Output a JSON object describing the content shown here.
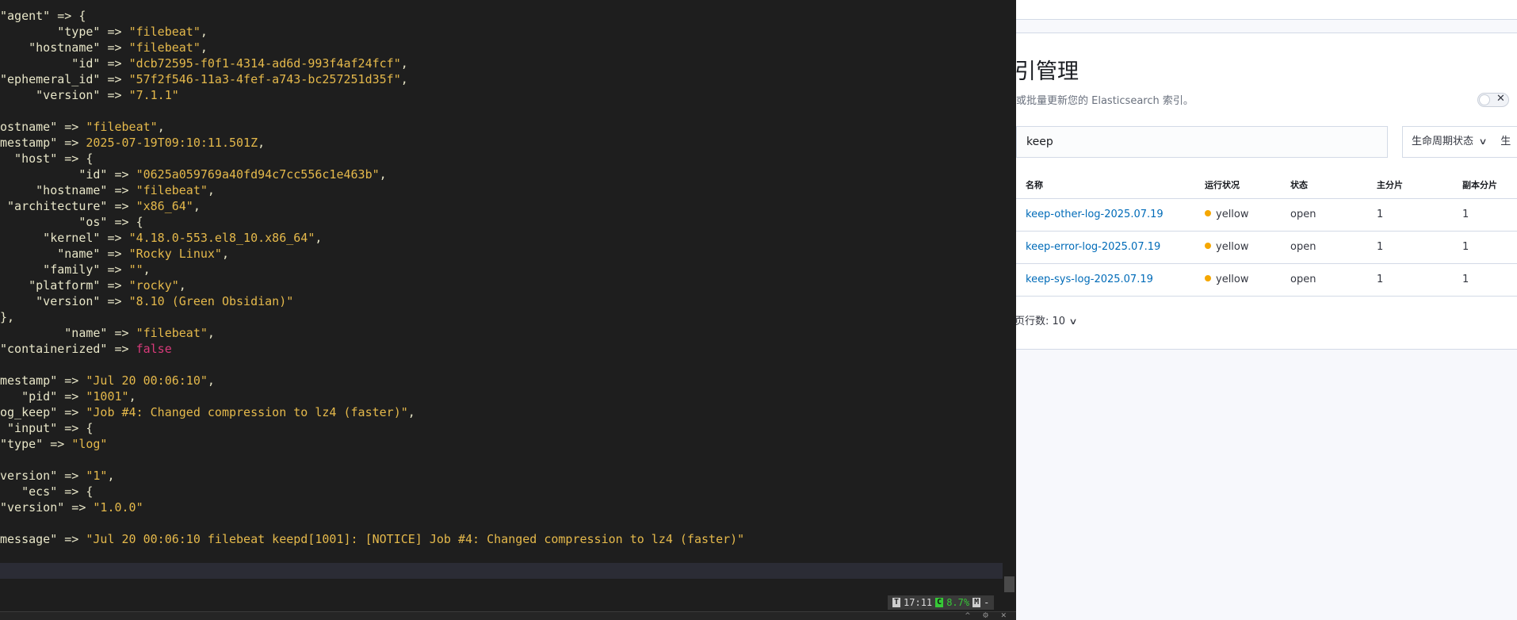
{
  "terminal": {
    "lines": [
      [
        [
          "k",
          "\"agent\" => {"
        ]
      ],
      [
        [
          "k",
          "        \"type\" => "
        ],
        [
          "s",
          "\"filebeat\""
        ],
        [
          "p",
          ","
        ]
      ],
      [
        [
          "k",
          "    \"hostname\" => "
        ],
        [
          "s",
          "\"filebeat\""
        ],
        [
          "p",
          ","
        ]
      ],
      [
        [
          "k",
          "          \"id\" => "
        ],
        [
          "s",
          "\"dcb72595-f0f1-4314-ad6d-993f4af24fcf\""
        ],
        [
          "p",
          ","
        ]
      ],
      [
        [
          "k",
          "\"ephemeral_id\" => "
        ],
        [
          "s",
          "\"57f2f546-11a3-4fef-a743-bc257251d35f\""
        ],
        [
          "p",
          ","
        ]
      ],
      [
        [
          "k",
          "     \"version\" => "
        ],
        [
          "s",
          "\"7.1.1\""
        ]
      ],
      [],
      [
        [
          "k",
          "ostname\" => "
        ],
        [
          "s",
          "\"filebeat\""
        ],
        [
          "p",
          ","
        ]
      ],
      [
        [
          "k",
          "mestamp\" => "
        ],
        [
          "s",
          "2025-07-19T09:10:11.501Z"
        ],
        [
          "p",
          ","
        ]
      ],
      [
        [
          "k",
          "  \"host\" => {"
        ]
      ],
      [
        [
          "k",
          "           \"id\" => "
        ],
        [
          "s",
          "\"0625a059769a40fd94c7cc556c1e463b\""
        ],
        [
          "p",
          ","
        ]
      ],
      [
        [
          "k",
          "     \"hostname\" => "
        ],
        [
          "s",
          "\"filebeat\""
        ],
        [
          "p",
          ","
        ]
      ],
      [
        [
          "k",
          " \"architecture\" => "
        ],
        [
          "s",
          "\"x86_64\""
        ],
        [
          "p",
          ","
        ]
      ],
      [
        [
          "k",
          "           \"os\" => {"
        ]
      ],
      [
        [
          "k",
          "      \"kernel\" => "
        ],
        [
          "s",
          "\"4.18.0-553.el8_10.x86_64\""
        ],
        [
          "p",
          ","
        ]
      ],
      [
        [
          "k",
          "        \"name\" => "
        ],
        [
          "s",
          "\"Rocky Linux\""
        ],
        [
          "p",
          ","
        ]
      ],
      [
        [
          "k",
          "      \"family\" => "
        ],
        [
          "s",
          "\"\""
        ],
        [
          "p",
          ","
        ]
      ],
      [
        [
          "k",
          "    \"platform\" => "
        ],
        [
          "s",
          "\"rocky\""
        ],
        [
          "p",
          ","
        ]
      ],
      [
        [
          "k",
          "     \"version\" => "
        ],
        [
          "s",
          "\"8.10 (Green Obsidian)\""
        ]
      ],
      [
        [
          "k",
          "},"
        ]
      ],
      [
        [
          "k",
          "         \"name\" => "
        ],
        [
          "s",
          "\"filebeat\""
        ],
        [
          "p",
          ","
        ]
      ],
      [
        [
          "k",
          "\"containerized\" => "
        ],
        [
          "b",
          "false"
        ]
      ],
      [],
      [
        [
          "k",
          "mestamp\" => "
        ],
        [
          "s",
          "\"Jul 20 00:06:10\""
        ],
        [
          "p",
          ","
        ]
      ],
      [
        [
          "k",
          "   \"pid\" => "
        ],
        [
          "s",
          "\"1001\""
        ],
        [
          "p",
          ","
        ]
      ],
      [
        [
          "k",
          "og_keep\" => "
        ],
        [
          "s",
          "\"Job #4: Changed compression to lz4 (faster)\""
        ],
        [
          "p",
          ","
        ]
      ],
      [
        [
          "k",
          " \"input\" => {"
        ]
      ],
      [
        [
          "k",
          "\"type\" => "
        ],
        [
          "s",
          "\"log\""
        ]
      ],
      [],
      [
        [
          "k",
          "version\" => "
        ],
        [
          "s",
          "\"1\""
        ],
        [
          "p",
          ","
        ]
      ],
      [
        [
          "k",
          "   \"ecs\" => {"
        ]
      ],
      [
        [
          "k",
          "\"version\" => "
        ],
        [
          "s",
          "\"1.0.0\""
        ]
      ],
      [],
      [
        [
          "k",
          "message\" => "
        ],
        [
          "s",
          "\"Jul 20 00:06:10 filebeat keepd[1001]: [NOTICE] Job #4: Changed compression to lz4 (faster)\""
        ]
      ]
    ],
    "status": {
      "tag": "T",
      "time": "17:11",
      "cpu_tag": "C",
      "cpu": "8.7%",
      "mem_tag": "M",
      "dash": "-"
    },
    "bottom_icons": "^ ⚙ ✕"
  },
  "kibana": {
    "title": "引管理",
    "description": "或批量更新您的 Elasticsearch 索引。",
    "search_value": "keep",
    "filter_label": "生命周期状态",
    "filter_label2": "生",
    "columns": [
      "名称",
      "运行状况",
      "状态",
      "主分片",
      "副本分片"
    ],
    "rows": [
      {
        "name": "keep-other-log-2025.07.19",
        "health": "yellow",
        "status": "open",
        "primary": "1",
        "replica": "1"
      },
      {
        "name": "keep-error-log-2025.07.19",
        "health": "yellow",
        "status": "open",
        "primary": "1",
        "replica": "1"
      },
      {
        "name": "keep-sys-log-2025.07.19",
        "health": "yellow",
        "status": "open",
        "primary": "1",
        "replica": "1"
      }
    ],
    "pager": "页行数: 10",
    "health_color": "#f5a700",
    "link_color": "#006bb8"
  }
}
